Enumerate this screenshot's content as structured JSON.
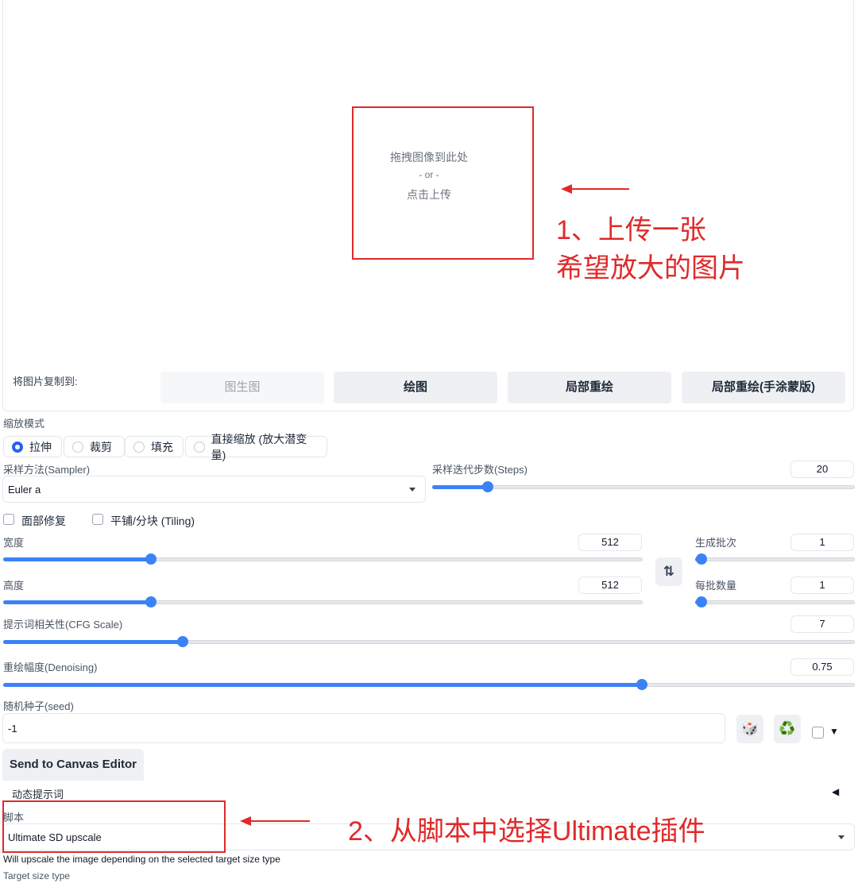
{
  "upload": {
    "drop_text": "拖拽图像到此处",
    "or_text": "- or -",
    "click_text": "点击上传"
  },
  "copy_to": {
    "label": "将图片复制到:",
    "buttons": [
      "图生图",
      "绘图",
      "局部重绘",
      "局部重绘(手涂蒙版)"
    ]
  },
  "annotation1": {
    "line1": "1、上传一张",
    "line2": "希望放大的图片"
  },
  "resize_mode": {
    "label": "缩放模式",
    "options": [
      "拉伸",
      "裁剪",
      "填充",
      "直接缩放 (放大潜变量)"
    ],
    "selected": "拉伸"
  },
  "sampler": {
    "label": "采样方法(Sampler)",
    "value": "Euler a"
  },
  "steps": {
    "label": "采样迭代步数(Steps)",
    "value": "20",
    "fraction": 0.13
  },
  "checkboxes": {
    "face_restore": "面部修复",
    "tiling": "平铺/分块 (Tiling)"
  },
  "width": {
    "label": "宽度",
    "value": "512",
    "fraction": 0.23
  },
  "height": {
    "label": "高度",
    "value": "512",
    "fraction": 0.23
  },
  "batch_count": {
    "label": "生成批次",
    "value": "1",
    "fraction": 0.0
  },
  "batch_size": {
    "label": "每批数量",
    "value": "1",
    "fraction": 0.0
  },
  "swap_icon": "⇅",
  "cfg": {
    "label": "提示词相关性(CFG Scale)",
    "value": "7",
    "fraction": 0.21
  },
  "denoise": {
    "label": "重绘幅度(Denoising)",
    "value": "0.75",
    "fraction": 0.75
  },
  "seed": {
    "label": "随机种子(seed)",
    "value": "-1",
    "dice_icon": "🎲",
    "recycle_icon": "♻️",
    "expand_icon": "▼"
  },
  "canvas_button": "Send to Canvas Editor",
  "dynamic_prompts": {
    "label": "动态提示词",
    "toggle_icon": "◀"
  },
  "script": {
    "label": "脚本",
    "value": "Ultimate SD upscale"
  },
  "annotation2": "2、从脚本中选择Ultimate插件",
  "upscale_note": "Will upscale the image depending on the selected target size type",
  "target_size_label": "Target size type",
  "colors": {
    "accent": "#3b82f6",
    "annotation": "#e02a2a"
  }
}
